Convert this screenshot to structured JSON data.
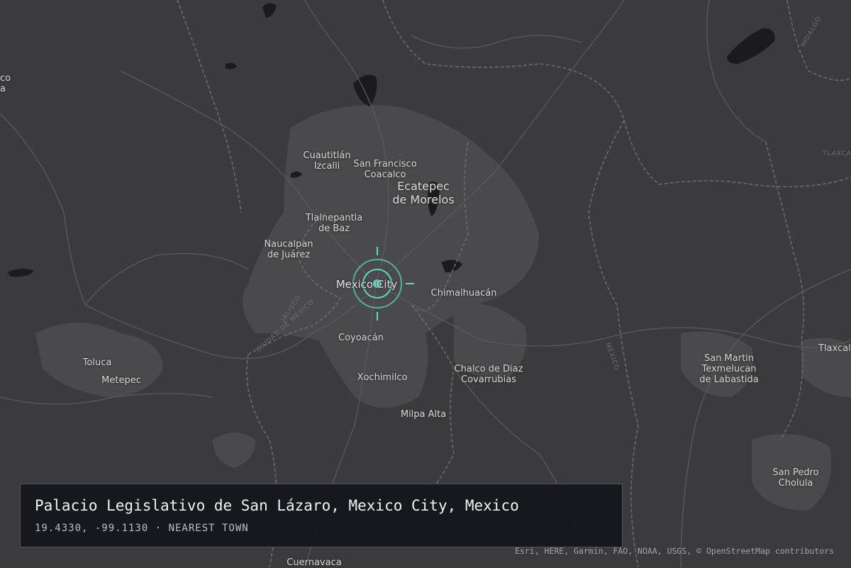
{
  "map": {
    "places": {
      "cuautitlan": "Cuautitlán\nIzcalli",
      "san_francisco": "San Francisco\nCoacalco",
      "ecatepec": "Ecatepec\nde Morelos",
      "tlalnepantla": "Tlalnepantla\nde Baz",
      "naucalpan": "Naucalpan\nde Juárez",
      "mexico_city": "Mexico City",
      "chimalhuacan": "Chimalhuacán",
      "coyoacan": "Coyoacán",
      "toluca": "Toluca",
      "metepec": "Metepec",
      "xochimilco": "Xochimilco",
      "chalco": "Chalco de Diaz\nCovarrubias",
      "milpa_alta": "Milpa Alta",
      "san_martin": "San Martin\nTexmelucan\nde Labastida",
      "tlaxcala": "Tlaxcala",
      "san_pedro": "San Pedro\nCholula",
      "cuernavaca": "Cuernavaca",
      "left_edge": "co\na"
    },
    "region_labels": {
      "hidalgo": "HIDALGO",
      "tlaxca": "TLAXCA",
      "jalisco": "JALISCO",
      "ciudad": "CIUDAD DE MÉXICO",
      "mexico": "MEXICO"
    },
    "colors": {
      "background": "#3b3b3d",
      "urban": "#4a4a4c",
      "water": "#1b1b1d",
      "road": "#5a5a5c",
      "border": "#6a6a6c",
      "marker": "#5fd8c0"
    }
  },
  "info": {
    "title": "Palacio Legislativo de San Lázaro, Mexico City, Mexico",
    "subtitle": "19.4330, -99.1130 · NEAREST TOWN"
  },
  "attribution": "Esri, HERE, Garmin, FAO, NOAA, USGS, © OpenStreetMap contributors"
}
